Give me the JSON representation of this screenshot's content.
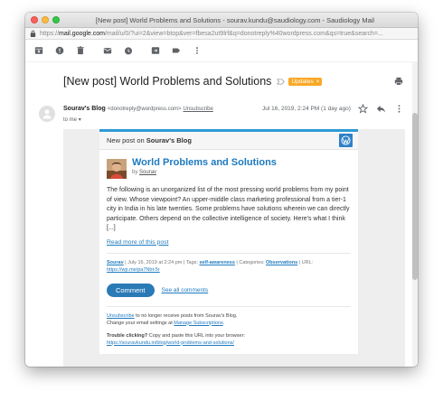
{
  "window": {
    "title": "[New post] World Problems and Solutions - sourav.kundu@saudiology.com - Saudiology Mail"
  },
  "address_bar": {
    "prefix": "https://",
    "host": "mail.google.com",
    "path": "/mail/u/0/?ui=2&view=btop&ver=fbesa2ut9lrf&q=donotreply%40wordpress.com&qs=true&search=..."
  },
  "toolbar": {
    "icons": [
      "archive-icon",
      "report-spam-icon",
      "delete-icon",
      "mark-unread-icon",
      "snooze-icon",
      "move-to-icon",
      "labels-icon",
      "more-icon"
    ]
  },
  "message": {
    "subject": "[New post] World Problems and Solutions",
    "label_badge": "Updates",
    "label_close": "×",
    "sender_name": "Sourav's Blog",
    "sender_email": "<donotreply@wordpress.com>",
    "unsubscribe": "Unsubscribe",
    "to_me": "to me",
    "date": "Jul 16, 2019, 2:24 PM (1 day ago)"
  },
  "email": {
    "header_prefix": "New post on ",
    "header_blog": "Sourav's Blog",
    "post_title": "World Problems and Solutions",
    "by_prefix": "by ",
    "author": "Sourav",
    "excerpt": "The following is an unorganized list of the most pressing world problems from my point of view. Whose viewpoint? An upper-middle class marketing professional from a tier-1 city in India in his late twenties. Some problems have solutions wherein we can directly participate. Others depend on the collective intelligence of society. Here's what I think [...]",
    "read_more": "Read more of this post",
    "meta_author": "Sourav",
    "meta_date": " | July 16, 2019 at 2:24 pm | Tags: ",
    "meta_tags": "self-awareness",
    "meta_categories_prefix": " | Categories: ",
    "meta_category": "Observations",
    "meta_url_prefix": " | URL: ",
    "meta_url": "https://wp.me/pa7Nbt-5r",
    "comment_button": "Comment",
    "see_all": "See all comments",
    "footer_unsub": "Unsubscribe",
    "footer_unsub_text": " to no longer receive posts from Sourav's Blog.",
    "footer_settings_text": "Change your email settings at ",
    "footer_settings_link": "Manage Subscriptions",
    "footer_period": ".",
    "footer_trouble_label": "Trouble clicking?",
    "footer_trouble_text": " Copy and paste this URL into your browser:",
    "footer_trouble_url": "https://souravkundu.in/blog/world-problems-and-solutions/"
  },
  "colors": {
    "accent": "#1e7abf",
    "badge": "#f9a825",
    "wp_blue": "#2e81c8"
  }
}
